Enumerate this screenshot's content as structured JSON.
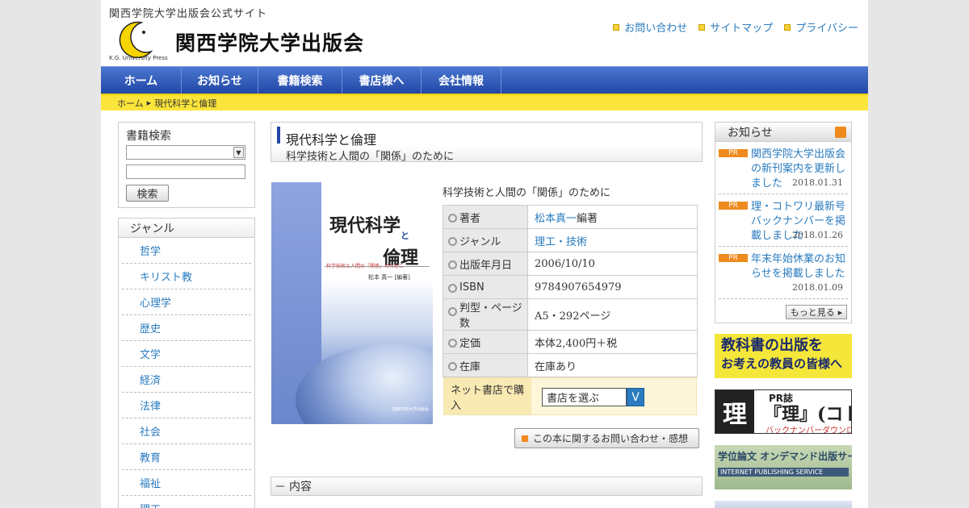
{
  "header": {
    "tagline": "関西学院大学出版会公式サイト",
    "logo_name": "関西学院大学出版会",
    "logo_press": "K.G. University Press",
    "links": [
      "お問い合わせ",
      "サイトマップ",
      "プライバシー"
    ]
  },
  "nav": {
    "items": [
      "ホーム",
      "お知らせ",
      "書籍検索",
      "書店様へ",
      "会社情報"
    ]
  },
  "breadcrumb": {
    "home": "ホーム",
    "current": "現代科学と倫理"
  },
  "search": {
    "title": "書籍検索",
    "button": "検索"
  },
  "genre": {
    "title": "ジャンル",
    "items": [
      "哲学",
      "キリスト教",
      "心理学",
      "歴史",
      "文学",
      "経済",
      "法律",
      "社会",
      "教育",
      "福祉",
      "理工"
    ]
  },
  "book": {
    "title": "現代科学と倫理",
    "subtitle": "科学技術と人間の「関係」のために",
    "cover_title1": "現代科学",
    "cover_to": "と",
    "cover_title2": "倫理",
    "cover_caption": "科学技術と人間の「関係」のために",
    "cover_author": "松本 真一 [編著]",
    "cover_publisher": "関西学院大学出版会",
    "details": [
      {
        "key": "著者",
        "value": "松本真一",
        "extra": "編著"
      },
      {
        "key": "ジャンル",
        "value": "理工・技術"
      },
      {
        "key": "出版年月日",
        "value": "2006/10/10"
      },
      {
        "key": "ISBN",
        "value": "9784907654979"
      },
      {
        "key": "判型・ページ数",
        "value": "A5・292ページ"
      },
      {
        "key": "定価",
        "value": "本体2,400円＋税"
      },
      {
        "key": "在庫",
        "value": "在庫あり"
      }
    ],
    "buy_label": "ネット書店で購入",
    "buy_select": "書店を選ぶ",
    "buy_arrow": "V",
    "inquiry_button": "この本に関するお問い合わせ・感想",
    "content_heading": "内容"
  },
  "news": {
    "title": "お知らせ",
    "items": [
      {
        "badge": "PR",
        "title": "関西学院大学出版会の新刊案内を更新しました",
        "date": "2018.01.31"
      },
      {
        "badge": "PR",
        "title": "理・コトワリ最新号バックナンバーを掲載しました",
        "date": "2018.01.26"
      },
      {
        "badge": "PR",
        "title": "年末年始休業のお知らせを掲載しました",
        "date": "2018.01.09"
      }
    ],
    "more": "もっと見る"
  },
  "banners": {
    "textbook_line1": "教科書の出版を",
    "textbook_line2": "お考えの教員の皆様へ",
    "kotowari_ri": "理",
    "kotowari_pr": "PR誌",
    "kotowari_main": "『理』(コトワリ)",
    "kotowari_sub": "バックナンバーダウンロード",
    "thesis_line1": "学位論文 オンデマンド出版サービス",
    "thesis_line2": "INTERNET PUBLISHING SERVICE"
  },
  "colors": {
    "nav_blue": "#2247a6",
    "highlight_yellow": "#fbe53a",
    "link_blue": "#2a7bbf",
    "pr_orange": "#ef8a1e"
  }
}
